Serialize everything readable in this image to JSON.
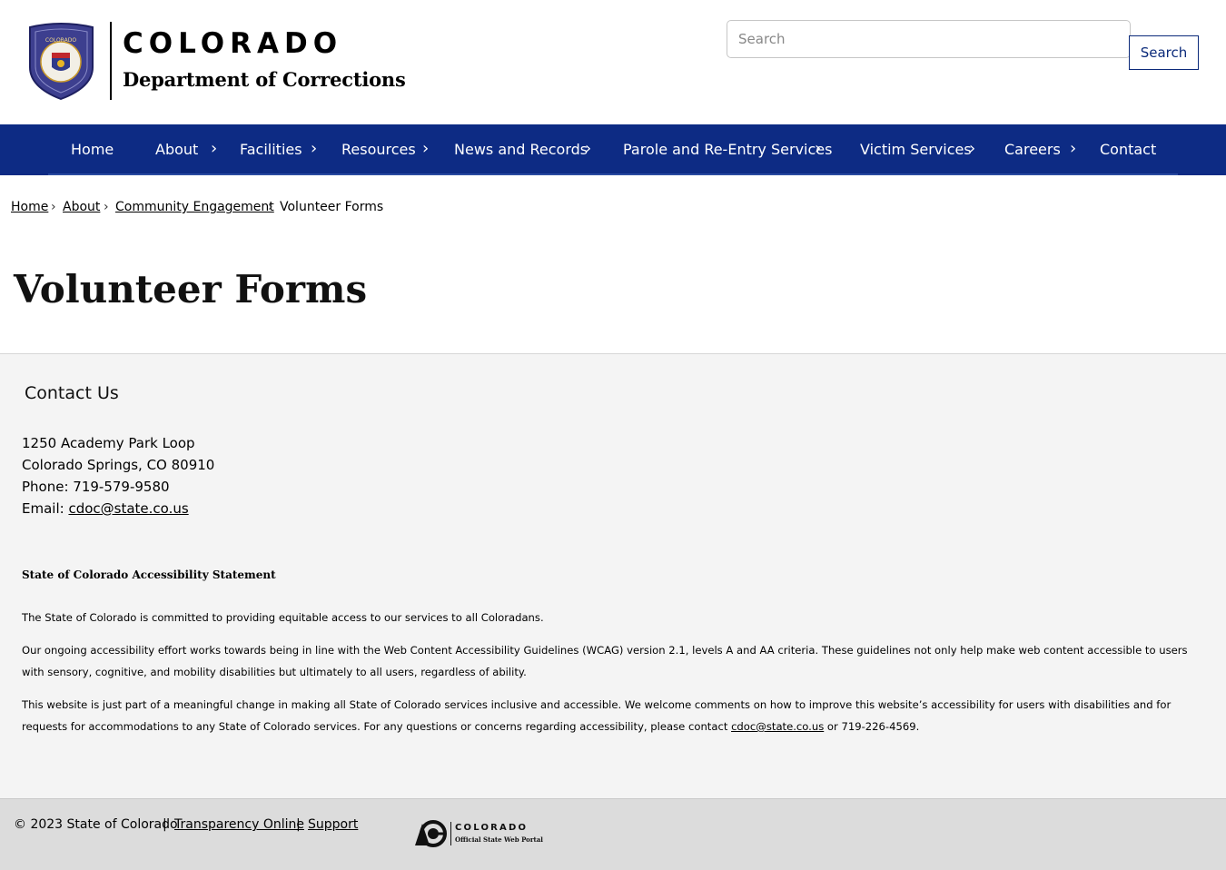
{
  "header": {
    "brand_title": "COLORADO",
    "brand_subtitle": "Department of Corrections",
    "search_placeholder": "Search",
    "search_button": "Search",
    "seal_icon": "colorado-doc-seal-icon"
  },
  "nav": {
    "items": [
      {
        "label": "Home",
        "has_submenu": false
      },
      {
        "label": "About",
        "has_submenu": true
      },
      {
        "label": "Facilities",
        "has_submenu": true
      },
      {
        "label": "Resources",
        "has_submenu": true
      },
      {
        "label": "News and Records",
        "has_submenu": true
      },
      {
        "label": "Parole and Re-Entry Services",
        "has_submenu": true
      },
      {
        "label": "Victim Services",
        "has_submenu": true
      },
      {
        "label": "Careers",
        "has_submenu": true
      },
      {
        "label": "Contact",
        "has_submenu": false
      }
    ],
    "chevron": "›"
  },
  "breadcrumb": {
    "items": [
      "Home",
      "About",
      "Community Engagement",
      "Volunteer Forms"
    ],
    "separator": "›"
  },
  "page": {
    "title": "Volunteer Forms"
  },
  "contact": {
    "heading": "Contact Us",
    "address_line1": "1250 Academy Park Loop",
    "address_line2": "Colorado Springs, CO 80910",
    "phone": "Phone: 719-579-9580",
    "email_label": "Email: ",
    "email": "cdoc@state.co.us"
  },
  "accessibility": {
    "heading": "State of Colorado Accessibility Statement",
    "p1": "The State of Colorado is committed to providing equitable access to our services to all Coloradans.",
    "p2": "Our ongoing accessibility effort works towards being in line with the Web Content Accessibility Guidelines (WCAG) version 2.1, levels A and AA criteria. These guidelines not only help make web content accessible to users with sensory, cognitive, and mobility disabilities but ultimately to all users, regardless of ability.",
    "p3_before": "This website is just part of a meaningful change in making all State of Colorado services inclusive and accessible. We welcome comments on how to improve this website’s accessibility for users with disabilities and for requests for accommodations to any State of Colorado services. For any questions or concerns regarding accessibility, please contact ",
    "p3_link": "cdoc@state.co.us",
    "p3_after": " or 719-226-4569."
  },
  "footer": {
    "copyright": "© 2023 State of Colorado",
    "sep": "|",
    "transparency": "Transparency Online",
    "support": "Support",
    "portal_word": "COLORADO",
    "portal_sub": "Official State Web Portal"
  },
  "colors": {
    "nav_bg": "#0d2b84",
    "contact_bg": "#f4f4f4",
    "footer_bg": "#dcdcdc"
  }
}
